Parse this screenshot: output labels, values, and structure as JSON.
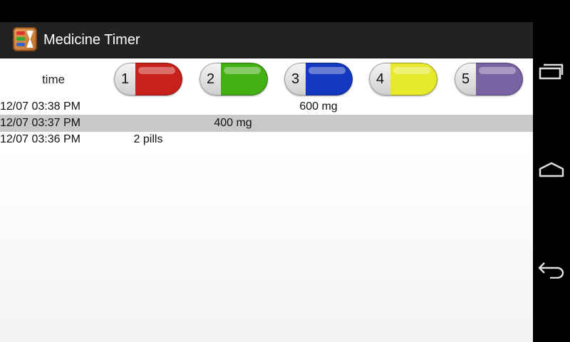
{
  "app": {
    "title": "Medicine Timer"
  },
  "header": {
    "time_label": "time",
    "pills": [
      {
        "number": "1",
        "color": "#c8201a"
      },
      {
        "number": "2",
        "color": "#43b012"
      },
      {
        "number": "3",
        "color": "#1438c0"
      },
      {
        "number": "4",
        "color": "#e6ea2a"
      },
      {
        "number": "5",
        "color": "#7a63a3"
      }
    ]
  },
  "entries": [
    {
      "time": "12/07 03:38 PM",
      "pill1": "",
      "pill2": "",
      "pill3": "600 mg",
      "pill4": "",
      "pill5": "",
      "highlight": false
    },
    {
      "time": "12/07 03:37 PM",
      "pill1": "",
      "pill2": "400 mg",
      "pill3": "",
      "pill4": "",
      "pill5": "",
      "highlight": true
    },
    {
      "time": "12/07 03:36 PM",
      "pill1": "2 pills",
      "pill2": "",
      "pill3": "",
      "pill4": "",
      "pill5": "",
      "highlight": false
    }
  ],
  "colors": {
    "highlight_row": "#c8c8c8",
    "actionbar": "#222222"
  }
}
